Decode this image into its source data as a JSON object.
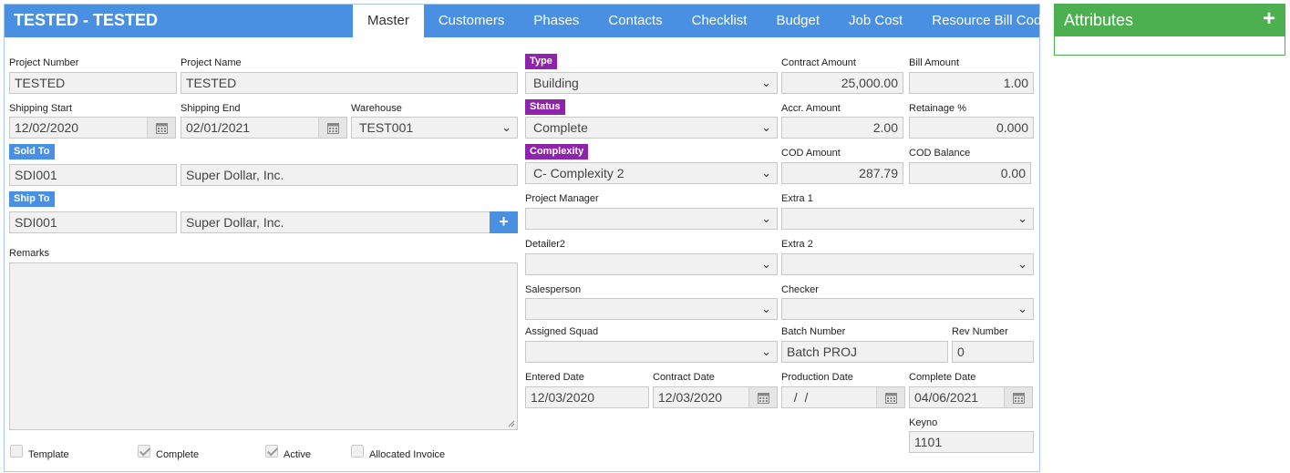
{
  "header": {
    "title": "TESTED - TESTED",
    "tabs": [
      "Master",
      "Customers",
      "Phases",
      "Contacts",
      "Checklist",
      "Budget",
      "Job Cost",
      "Resource Bill Codes"
    ],
    "active_tab": "Master"
  },
  "left": {
    "project_number": {
      "label": "Project Number",
      "value": "TESTED"
    },
    "project_name": {
      "label": "Project Name",
      "value": "TESTED"
    },
    "shipping_start": {
      "label": "Shipping Start",
      "value": "12/02/2020"
    },
    "shipping_end": {
      "label": "Shipping End",
      "value": "02/01/2021"
    },
    "warehouse": {
      "label": "Warehouse",
      "value": "TEST001"
    },
    "sold_to": {
      "label": "Sold To",
      "code": "SDI001",
      "name": "Super Dollar, Inc."
    },
    "ship_to": {
      "label": "Ship To",
      "code": "SDI001",
      "name": "Super Dollar, Inc.",
      "add_symbol": "+"
    },
    "remarks": {
      "label": "Remarks",
      "value": ""
    },
    "checkboxes": [
      {
        "label": "Template",
        "checked": false
      },
      {
        "label": "Complete",
        "checked": true
      },
      {
        "label": "Active",
        "checked": true
      },
      {
        "label": "Allocated Invoice",
        "checked": false
      }
    ]
  },
  "middle": {
    "type": {
      "label": "Type",
      "value": "Building"
    },
    "status": {
      "label": "Status",
      "value": "Complete"
    },
    "complexity": {
      "label": "Complexity",
      "value": "C- Complexity 2"
    },
    "project_manager": {
      "label": "Project Manager",
      "value": ""
    },
    "detailer2": {
      "label": "Detailer2",
      "value": ""
    },
    "salesperson": {
      "label": "Salesperson",
      "value": ""
    },
    "assigned_squad": {
      "label": "Assigned Squad",
      "value": ""
    },
    "entered_date": {
      "label": "Entered Date",
      "value": "12/03/2020"
    },
    "contract_date": {
      "label": "Contract Date",
      "value": "12/03/2020"
    }
  },
  "right": {
    "contract_amount": {
      "label": "Contract Amount",
      "value": "25,000.00"
    },
    "bill_amount": {
      "label": "Bill Amount",
      "value": "1.00"
    },
    "accr_amount": {
      "label": "Accr. Amount",
      "value": "2.00"
    },
    "retainage": {
      "label": "Retainage %",
      "value": "0.000"
    },
    "cod_amount": {
      "label": "COD Amount",
      "value": "287.79"
    },
    "cod_balance": {
      "label": "COD Balance",
      "value": "0.00"
    },
    "extra1": {
      "label": "Extra 1",
      "value": ""
    },
    "extra2": {
      "label": "Extra 2",
      "value": ""
    },
    "checker": {
      "label": "Checker",
      "value": ""
    },
    "batch_number": {
      "label": "Batch Number",
      "value": "Batch PROJ"
    },
    "rev_number": {
      "label": "Rev Number",
      "value": "0"
    },
    "production_date": {
      "label": "Production Date",
      "value": "  /  /"
    },
    "complete_date": {
      "label": "Complete Date",
      "value": "04/06/2021"
    },
    "keyno": {
      "label": "Keyno",
      "value": "1101"
    }
  },
  "attributes": {
    "title": "Attributes",
    "add_symbol": "+"
  },
  "colors": {
    "primary": "#4a90e2",
    "purple_tag": "#8e24aa",
    "attributes_green": "#4caf50"
  },
  "icons": {
    "chevron": "chevron-down-icon",
    "calendar": "calendar-icon",
    "plus": "plus-icon",
    "resize": "resize-grip-icon"
  }
}
